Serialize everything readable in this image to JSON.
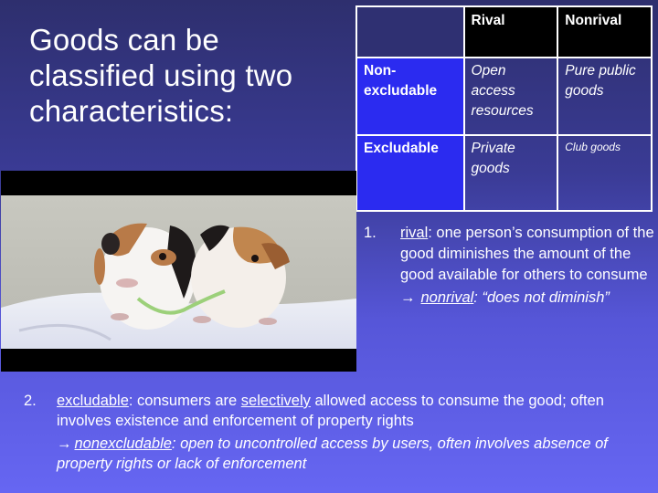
{
  "slide": {
    "title_lines": [
      "Goods can be",
      "classified using two",
      "characteristics:"
    ],
    "background_gradient": [
      "#2e2f6e",
      "#6666f2"
    ]
  },
  "table": {
    "column_headers": [
      "",
      "Rival",
      "Nonrival"
    ],
    "rows": [
      {
        "header": "Non-excludable",
        "header_lines": [
          "Non-",
          "excludable"
        ],
        "cells": [
          "Open access resources",
          "Pure public goods"
        ]
      },
      {
        "header": "Excludable",
        "header_lines": [
          "Excludable"
        ],
        "cells": [
          "Private goods",
          "Club goods"
        ]
      }
    ],
    "colors": {
      "header_row": "#000000",
      "row_header": "#2b2bf0",
      "border": "#ffffff"
    }
  },
  "image": {
    "description": "Two guinea pigs sharing a blade of grass on a white cloth",
    "icon": "guinea-pigs-photo"
  },
  "points": [
    {
      "number": "1.",
      "term": "rival",
      "definition": ": one person’s consumption of the good diminishes the amount of the good available for others to consume",
      "contrast_arrow": "→",
      "contrast_term": "nonrival",
      "contrast_definition": ": “does not diminish”"
    },
    {
      "number": "2.",
      "term": "excludable",
      "definition_pre": ": consumers are ",
      "definition_emph": "selectively",
      "definition_post": " allowed access to consume the good; often involves existence and enforcement of property rights",
      "contrast_arrow": "→",
      "contrast_term": "nonexcludable",
      "contrast_definition": ": open to uncontrolled access by users, often involves absence of property rights or lack of enforcement"
    }
  ]
}
